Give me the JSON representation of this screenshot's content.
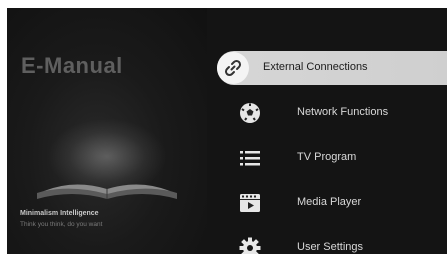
{
  "app": {
    "title": "E-Manual",
    "tagline": "Minimalism Intelligence",
    "subtagline": "Think you think, do you want"
  },
  "menu": {
    "items": [
      {
        "label": "External Connections",
        "icon": "link-icon",
        "selected": true
      },
      {
        "label": "Network Functions",
        "icon": "soccer-ball-icon",
        "selected": false
      },
      {
        "label": "TV Program",
        "icon": "list-icon",
        "selected": false
      },
      {
        "label": "Media Player",
        "icon": "film-play-icon",
        "selected": false
      },
      {
        "label": "User Settings",
        "icon": "gear-icon",
        "selected": false
      }
    ]
  },
  "colors": {
    "background": "#141414",
    "selected_bg": "#d6d6d6",
    "text": "#d8d8d8",
    "title": "#5f5f5f"
  }
}
